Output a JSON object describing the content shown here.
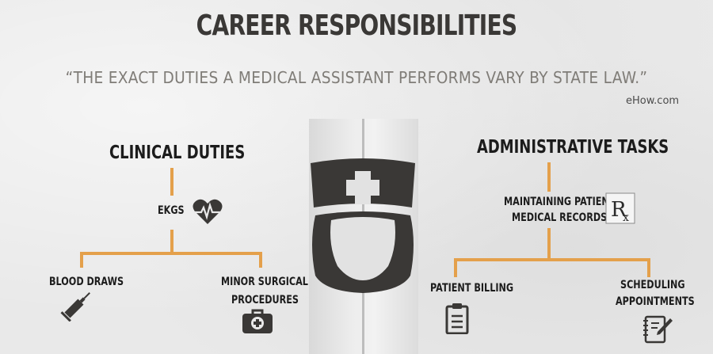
{
  "title": "CAREER RESPONSIBILITIES",
  "quote": "“THE EXACT DUTIES A MEDICAL ASSISTANT PERFORMS VARY BY STATE LAW.”",
  "source": "eHow.com",
  "clinical": {
    "heading": "CLINICAL DUTIES",
    "items": [
      "EKGS",
      "BLOOD DRAWS",
      "MINOR SURGICAL PROCEDURES"
    ],
    "minor_line1": "MINOR SURGICAL",
    "minor_line2": "PROCEDURES"
  },
  "administrative": {
    "heading": "ADMINISTRATIVE TASKS",
    "maintaining_line1": "MAINTAINING PATIENT",
    "maintaining_line2": "MEDICAL RECORDS",
    "billing": "PATIENT BILLING",
    "scheduling_line1": "SCHEDULING",
    "scheduling_line2": "APPOINTMENTS"
  },
  "icons": {
    "center": "nurse-icon",
    "ekg": "heart-ekg-icon",
    "blood": "syringe-icon",
    "surgical": "medical-kit-icon",
    "records": "rx-icon",
    "billing": "clipboard-icon",
    "scheduling": "notepad-pen-icon"
  },
  "colors": {
    "connector": "#e4a04b",
    "icon": "#3a3836",
    "title": "#3a3836",
    "quote": "#7f7c77"
  }
}
